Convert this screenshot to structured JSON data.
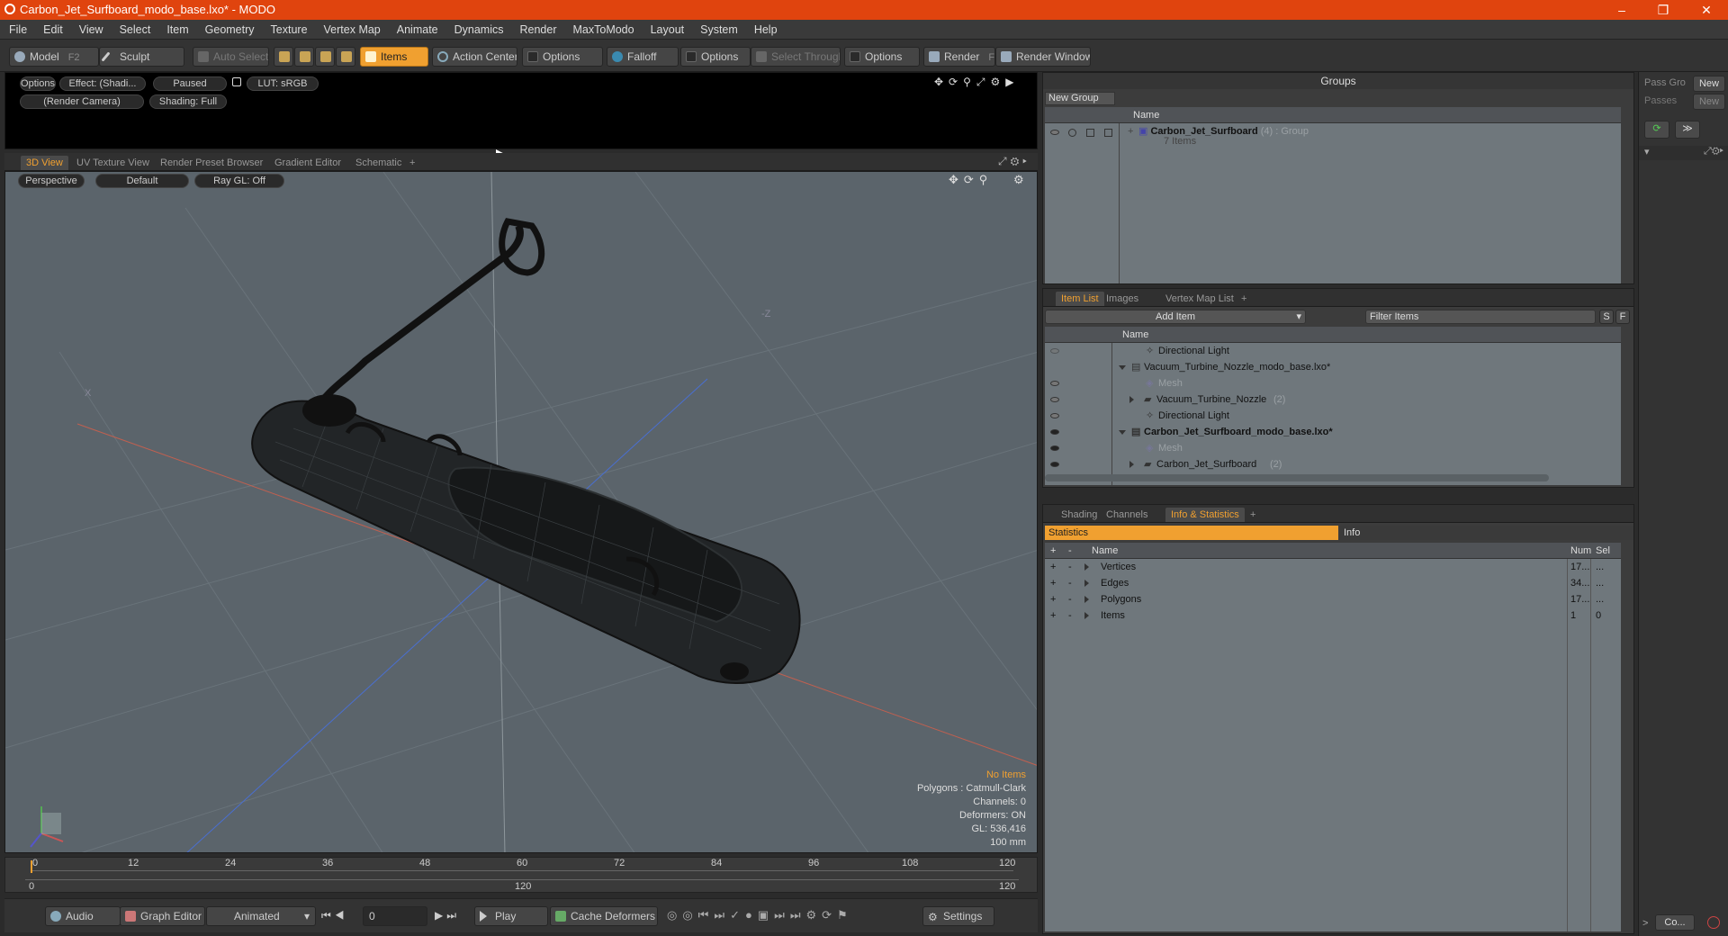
{
  "window": {
    "title": "Carbon_Jet_Surfboard_modo_base.lxo* - MODO",
    "min": "–",
    "max": "❐",
    "close": "✕"
  },
  "menu": [
    "File",
    "Edit",
    "View",
    "Select",
    "Item",
    "Geometry",
    "Texture",
    "Vertex Map",
    "Animate",
    "Dynamics",
    "Render",
    "MaxToModo",
    "Layout",
    "System",
    "Help"
  ],
  "toolbar": {
    "model": "Model",
    "model_key": "F2",
    "sculpt": "Sculpt",
    "auto_select": "Auto Select",
    "items": "Items",
    "action_center": "Action Center",
    "options1": "Options",
    "falloff": "Falloff",
    "options2": "Options",
    "select_through": "Select Through",
    "options3": "Options",
    "render": "Render",
    "render_key": "F9",
    "render_window": "Render Window"
  },
  "preview": {
    "options": "Options",
    "effect": "Effect: (Shadi...",
    "paused": "Paused",
    "lut": "LUT: sRGB",
    "camera": "(Render Camera)",
    "shading": "Shading: Full"
  },
  "view_tabs": [
    "3D View",
    "UV Texture View",
    "Render Preset Browser",
    "Gradient Editor",
    "Schematic",
    "+"
  ],
  "view3d": {
    "perspective": "Perspective",
    "default": "Default",
    "raygl": "Ray GL: Off",
    "axis_x": "X",
    "axis_z": "-Z"
  },
  "hud": {
    "no_items": "No Items",
    "polygons": "Polygons : Catmull-Clark",
    "channels": "Channels: 0",
    "deformers": "Deformers: ON",
    "gl": "GL: 536,416",
    "scale": "100 mm"
  },
  "timeline": {
    "ticks": [
      "0",
      "12",
      "24",
      "36",
      "48",
      "60",
      "72",
      "84",
      "96",
      "108",
      "120"
    ],
    "range_start": "0",
    "range_mid": "120",
    "range_end": "120"
  },
  "bottom": {
    "audio": "Audio",
    "graph_editor": "Graph Editor",
    "animated": "Animated",
    "frame": "0",
    "play": "Play",
    "cache": "Cache Deformers",
    "settings": "Settings"
  },
  "groups": {
    "title": "Groups",
    "new_group": "New Group",
    "col_name": "Name",
    "item_name": "Carbon_Jet_Surfboard",
    "item_count": "(4)",
    "item_type": ": Group",
    "item_sub": "7 Items",
    "pass_label": "Pass Gro",
    "passes": "Passes",
    "new1": "New",
    "new2": "New"
  },
  "itemlist": {
    "tabs": [
      "Item List",
      "Images",
      "Vertex Map List",
      "+"
    ],
    "add_item": "Add Item",
    "filter": "Filter Items",
    "s": "S",
    "f": "F",
    "col_name": "Name",
    "rows": [
      {
        "label": "Directional Light",
        "sub": ""
      },
      {
        "label": "Vacuum_Turbine_Nozzle_modo_base.lxo*",
        "sub": ""
      },
      {
        "label": "Mesh",
        "sub": ""
      },
      {
        "label": "Vacuum_Turbine_Nozzle",
        "sub": "(2)"
      },
      {
        "label": "Directional Light",
        "sub": ""
      },
      {
        "label": "Carbon_Jet_Surfboard_modo_base.lxo*",
        "sub": ""
      },
      {
        "label": "Mesh",
        "sub": ""
      },
      {
        "label": "Carbon_Jet_Surfboard",
        "sub": "(2)"
      }
    ]
  },
  "stats": {
    "tabs": [
      "Shading",
      "Channels",
      "Info & Statistics",
      "+"
    ],
    "statistics": "Statistics",
    "info": "Info",
    "col_name": "Name",
    "col_num": "Num",
    "col_sel": "Sel",
    "rows": [
      {
        "name": "Vertices",
        "num": "17...",
        "sel": "..."
      },
      {
        "name": "Edges",
        "num": "34...",
        "sel": "..."
      },
      {
        "name": "Polygons",
        "num": "17...",
        "sel": "..."
      },
      {
        "name": "Items",
        "num": "1",
        "sel": "0"
      }
    ]
  },
  "right": {
    "co": "Co..."
  }
}
